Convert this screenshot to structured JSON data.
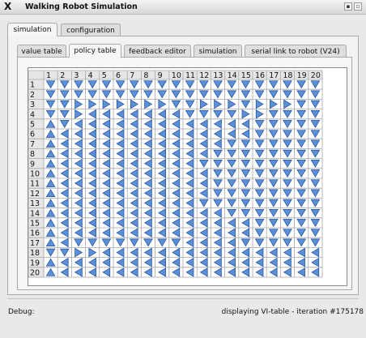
{
  "window": {
    "title": "Walking Robot Simulation",
    "icon": "x-window-logo-icon",
    "buttons": [
      "restore-button",
      "close-button"
    ]
  },
  "outer_tabs": [
    {
      "label": "simulation",
      "active": true
    },
    {
      "label": "configuration",
      "active": false
    }
  ],
  "inner_tabs": [
    {
      "label": "value table",
      "active": false
    },
    {
      "label": "policy table",
      "active": true
    },
    {
      "label": "feedback editor",
      "active": false
    },
    {
      "label": "simulation",
      "active": false
    },
    {
      "label": "serial link to robot (V24)",
      "active": false
    }
  ],
  "policy_table": {
    "column_headers": [
      "1",
      "2",
      "3",
      "4",
      "5",
      "6",
      "7",
      "8",
      "9",
      "10",
      "11",
      "12",
      "13",
      "14",
      "15",
      "16",
      "17",
      "18",
      "19",
      "20"
    ],
    "row_headers": [
      "1",
      "2",
      "3",
      "4",
      "5",
      "6",
      "7",
      "8",
      "9",
      "10",
      "11",
      "12",
      "13",
      "14",
      "15",
      "16",
      "17",
      "18",
      "19",
      "20"
    ],
    "arrow_legend": {
      "R": "arrow-right-icon",
      "D": "arrow-down-icon",
      "L": "arrow-left-icon",
      "U": "arrow-up-icon"
    },
    "arrows": [
      "DDDDDDDDDDDDDDDDDDDD",
      "DDDDDDDDDDDDDDDDDDDD",
      "DDRRRRRRRDDRRRDRRRDD",
      "DDRLLLLLLLDDDDRRDDDD",
      "UDLLLLLLLLLLLLLDDDDD",
      "ULLLLLLLLLLLLLLDDDDD",
      "ULLLLLLLLLLLLDDDDDDD",
      "ULLLLLLLLLLLDDDDDDDD",
      "ULLLLLLLLLLDDDDDDDDD",
      "ULLLLLLLLLLLDDDDDDDD",
      "ULLLLLLLLLLLDDDDDDDD",
      "ULLLLLLLLLLLDDDDDDDD",
      "ULLLLLLLLLLDDDDDDDDD",
      "ULLLLLLLLLLLLDDDDDDD",
      "ULLLLLLLLLLLLLLDDDDD",
      "ULLLLLLLLLLLLLLDDDDD",
      "ULDDDDDDDDLLLLDDDDDD",
      "DDRRLLLLLLLLLLLLLLLL",
      "ULLLLLLLLLLLLLLLLLLL",
      "ULLLLLLLLLLLLLLLLLLL"
    ]
  },
  "status": {
    "debug_label": "Debug:",
    "message": "displaying VI-table - iteration #175178"
  },
  "colors": {
    "arrow_fill": "#5b8fd6",
    "arrow_stroke": "#1f4e9e",
    "header_bg": "#e6e6e6",
    "grid_line": "#a8a8a8"
  }
}
